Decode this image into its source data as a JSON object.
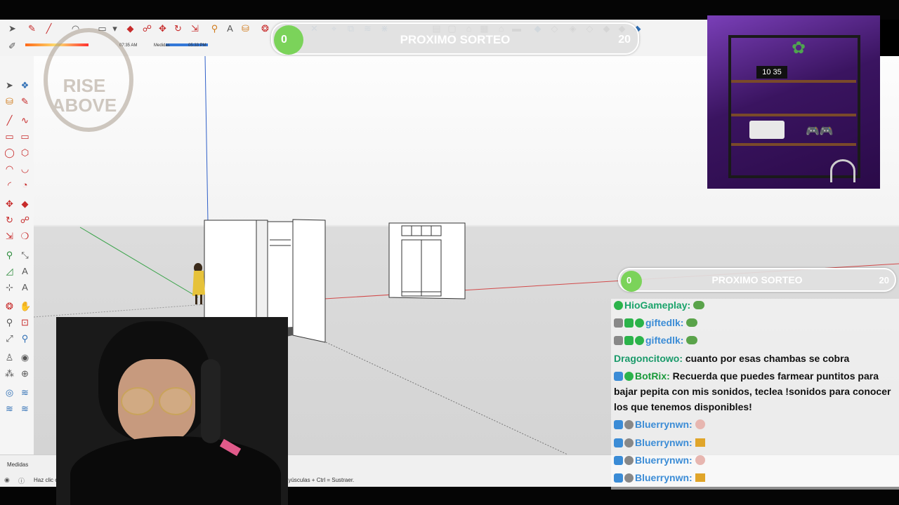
{
  "giveaway_top": {
    "current": "0",
    "title": "PROXIMO SORTEO",
    "goal": "20"
  },
  "giveaway_side": {
    "current": "0",
    "title": "PROXIMO SORTEO",
    "goal": "20"
  },
  "toolbar": {
    "time_start": "07:35 AM",
    "measure_short": "Medidas",
    "time_end": "05:33 PM"
  },
  "logo": {
    "line1": "RISE",
    "line2": "ABOVE"
  },
  "statusbar": {
    "measurements_label": "Medidas",
    "hint_left": "Haz clic o",
    "hint_right": "ayúsculas + Ctrl = Sustraer."
  },
  "shelf_clock": {
    "hour": "10",
    "minute": "35"
  },
  "chat": {
    "messages": [
      {
        "user": "HioGameplay:",
        "text": "",
        "user_color": "#1aa36a",
        "badges": [
          "verified"
        ],
        "emote": "frog-emote"
      },
      {
        "user": "giftedlk:",
        "text": "",
        "user_color": "#3b8cd6",
        "badges": [
          "gift",
          "verified"
        ],
        "emote": "frog-emote"
      },
      {
        "user": "giftedlk:",
        "text": "",
        "user_color": "#3b8cd6",
        "badges": [
          "gift",
          "verified"
        ],
        "emote": "frog-emote"
      },
      {
        "user": "Dragoncitowo:",
        "text": "cuanto por esas chambas se cobra",
        "user_color": "#1a9a6a",
        "badges": []
      },
      {
        "user": "BotRix:",
        "text": "Recuerda que puedes farmear puntitos para bajar pepita con mis sonidos, teclea !sonidos para conocer los que tenemos disponibles!",
        "user_color": "#1a9a3a",
        "badges": [
          "bot",
          "verified"
        ]
      },
      {
        "user": "Bluerrynwn:",
        "text": "",
        "user_color": "#3b8cd6",
        "badges": [
          "bot",
          "sub"
        ],
        "emote": "face-emote"
      },
      {
        "user": "Bluerrynwn:",
        "text": "",
        "user_color": "#3b8cd6",
        "badges": [
          "bot",
          "sub"
        ],
        "emote": "cone-emote"
      },
      {
        "user": "Bluerrynwn:",
        "text": "",
        "user_color": "#3b8cd6",
        "badges": [
          "bot",
          "sub"
        ],
        "emote": "face-emote"
      },
      {
        "user": "Bluerrynwn:",
        "text": "",
        "user_color": "#3b8cd6",
        "badges": [
          "bot",
          "sub"
        ],
        "emote": "cone-emote"
      }
    ]
  },
  "colors": {
    "accent_green": "#7bd35a",
    "axis_red": "#d24a4a",
    "axis_green": "#3aa34a",
    "axis_blue": "#2f5fc8"
  }
}
